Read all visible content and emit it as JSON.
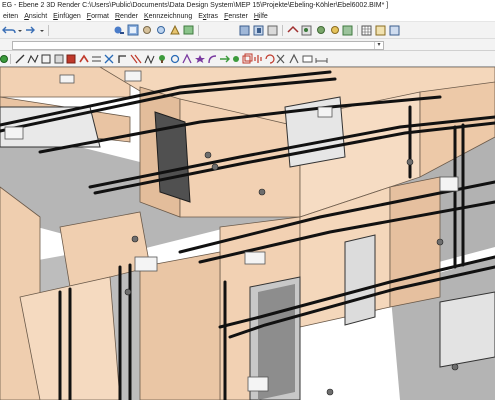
{
  "window": {
    "title": "EG - Ebene 2  3D  Render  C:\\Users\\Public\\Documents\\Data Design System\\MEP 15\\Projekte\\Ebeling-Köhler\\Ebel6002.BIM* ]"
  },
  "menu": {
    "items": [
      {
        "pre": "",
        "ul": "",
        "post": "eiten"
      },
      {
        "pre": "",
        "ul": "A",
        "post": "nsicht"
      },
      {
        "pre": "",
        "ul": "E",
        "post": "infügen"
      },
      {
        "pre": "",
        "ul": "F",
        "post": "ormat"
      },
      {
        "pre": "",
        "ul": "R",
        "post": "ender"
      },
      {
        "pre": "",
        "ul": "K",
        "post": "ennzeichnung"
      },
      {
        "pre": "E",
        "ul": "x",
        "post": "tras"
      },
      {
        "pre": "",
        "ul": "F",
        "post": "enster"
      },
      {
        "pre": "",
        "ul": "H",
        "post": "ilfe"
      }
    ]
  },
  "toolbar": {
    "dropdown_value": "",
    "dropdown_arrow": "▾",
    "icons_row1": [
      "undo-icon",
      "undo-dropdown-icon",
      "redo-icon",
      "redo-dropdown-icon",
      "zoom-window-icon",
      "zoom-extents-icon",
      "zoom-in-icon",
      "zoom-out-icon",
      "pan-icon",
      "pan-view-icon",
      "view-front-icon",
      "view-side-icon",
      "orbit-icon",
      "layer-icon",
      "layer-copy-icon",
      "text-icon",
      "hatch-icon",
      "measure-icon",
      "grid-icon",
      "table-icon",
      "window-icon"
    ],
    "icons_row3": [
      "snap-icon",
      "line-icon",
      "polyline-icon",
      "rectangle-icon",
      "circle-icon",
      "fill-icon",
      "duct-icon",
      "pipe-icon",
      "valve-icon",
      "fitting-icon",
      "cable-icon",
      "radiator-icon",
      "tree-icon",
      "pump-icon",
      "meter-icon",
      "star-icon",
      "bend-icon",
      "arrow-icon",
      "fan-icon",
      "copy-icon",
      "mirror-icon",
      "rotate-icon",
      "cut-icon",
      "nav-icon",
      "label-icon",
      "dimension-icon"
    ]
  },
  "colors": {
    "wall": "#f2d1b3",
    "wall_shade": "#e3bd9b",
    "floor": "#b4b4b4",
    "floor_dark": "#9c9c9c",
    "pipe": "#1a1a1a",
    "door_glass": "#4a4a4a",
    "window_frame": "#e4e4e4"
  }
}
